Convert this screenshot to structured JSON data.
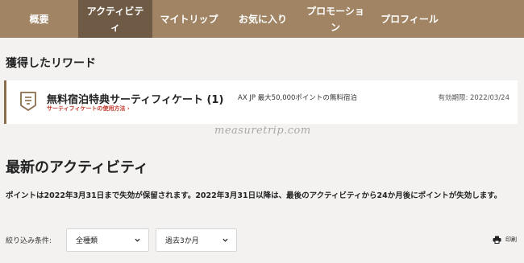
{
  "nav": {
    "items": [
      {
        "label": "概要"
      },
      {
        "label_line1": "アクティビテ",
        "label_line2": "ィ"
      },
      {
        "label": "マイトリップ"
      },
      {
        "label": "お気に入り"
      },
      {
        "label_line1": "プロモーショ",
        "label_line2": "ン"
      },
      {
        "label": "プロフィール"
      }
    ],
    "active_index": 1
  },
  "rewards": {
    "title": "獲得したリワード",
    "card": {
      "icon": "certificate-icon",
      "name": "無料宿泊特典サーティフィケート (1)",
      "link": "サーティフィケートの使用方法 ›",
      "description": "AX JP 最大50,000ポイントの無料宿泊",
      "expiry": "有効期限: 2022/03/24"
    }
  },
  "watermark": "measuretrip.com",
  "activity": {
    "title": "最新のアクティビティ",
    "notice": "ポイントは2022年3月31日まで失効が保留されます。2022年3月31日以降は、最後のアクティビティから24か月後にポイントが失効します。"
  },
  "filters": {
    "label": "絞り込み条件:",
    "type_value": "全種類",
    "period_value": "過去3か月",
    "print_label": "印刷"
  },
  "colors": {
    "nav_bg": "#a08463",
    "nav_active": "#6f5b45",
    "accent_border": "#8a6d4d",
    "link_red": "#c0392b"
  }
}
